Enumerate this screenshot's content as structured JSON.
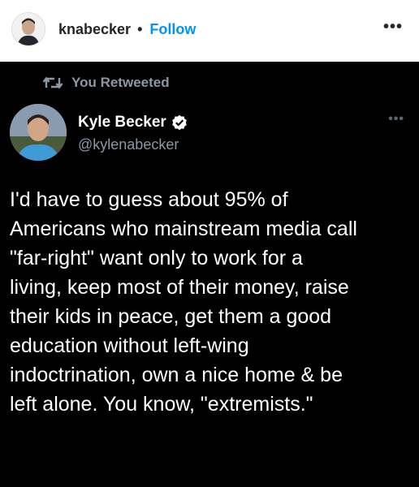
{
  "instagram": {
    "username": "knabecker",
    "separator": "•",
    "follow_label": "Follow",
    "more_label": "•••"
  },
  "tweet": {
    "retweet_label": "You Retweeted",
    "author_name": "Kyle Becker",
    "author_handle": "@kylenabecker",
    "more_label": "•••",
    "text": "I'd have to guess about 95% of\nAmericans who mainstream media call\n\"far-right\" want only to work for a\nliving, keep most of their money, raise\ntheir kids in peace, get them a good\neducation without left-wing\nindoctrination, own a nice home & be\nleft alone. You know, \"extremists.\""
  },
  "colors": {
    "follow_blue": "#0095f6",
    "tweet_background": "#000000",
    "secondary_text": "#8b98a5"
  },
  "icons": [
    "retweet-icon",
    "verified-badge-icon",
    "more-options-icon"
  ]
}
